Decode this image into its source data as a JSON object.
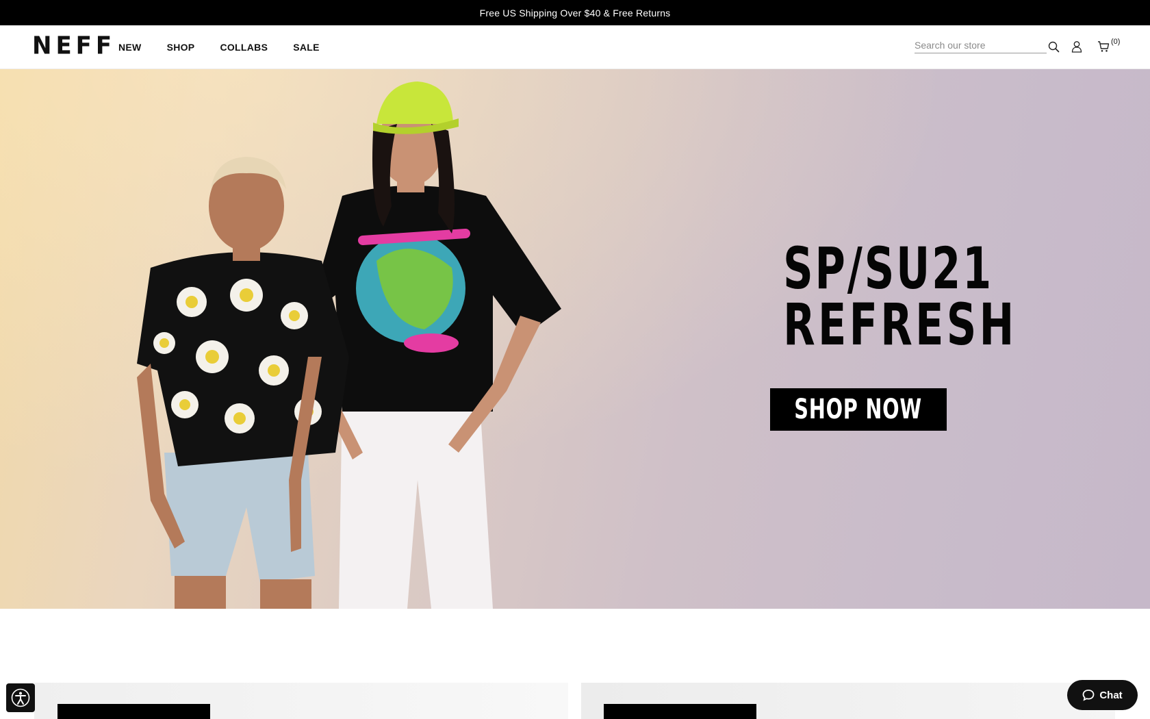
{
  "announcement": {
    "text": "Free US Shipping Over $40 & Free Returns"
  },
  "header": {
    "logo": "NEFF",
    "nav": [
      {
        "label": "NEW"
      },
      {
        "label": "SHOP"
      },
      {
        "label": "COLLABS"
      },
      {
        "label": "SALE"
      }
    ],
    "search": {
      "placeholder": "Search our store",
      "value": ""
    },
    "icons": {
      "search": "search-icon",
      "account": "user-icon",
      "cart": "cart-icon"
    },
    "cart_count": "(0)"
  },
  "hero": {
    "headline_line1": "SP/SU21",
    "headline_line2": "REFRESH",
    "cta_label": "SHOP NOW",
    "image_description": "two models wearing NEFF apparel, daisy print shirt and graphic tee with lime cap"
  },
  "chat": {
    "label": "Chat"
  },
  "colors": {
    "brand": "#000000",
    "background": "#ffffff",
    "accent_cap": "#c8e63a"
  }
}
